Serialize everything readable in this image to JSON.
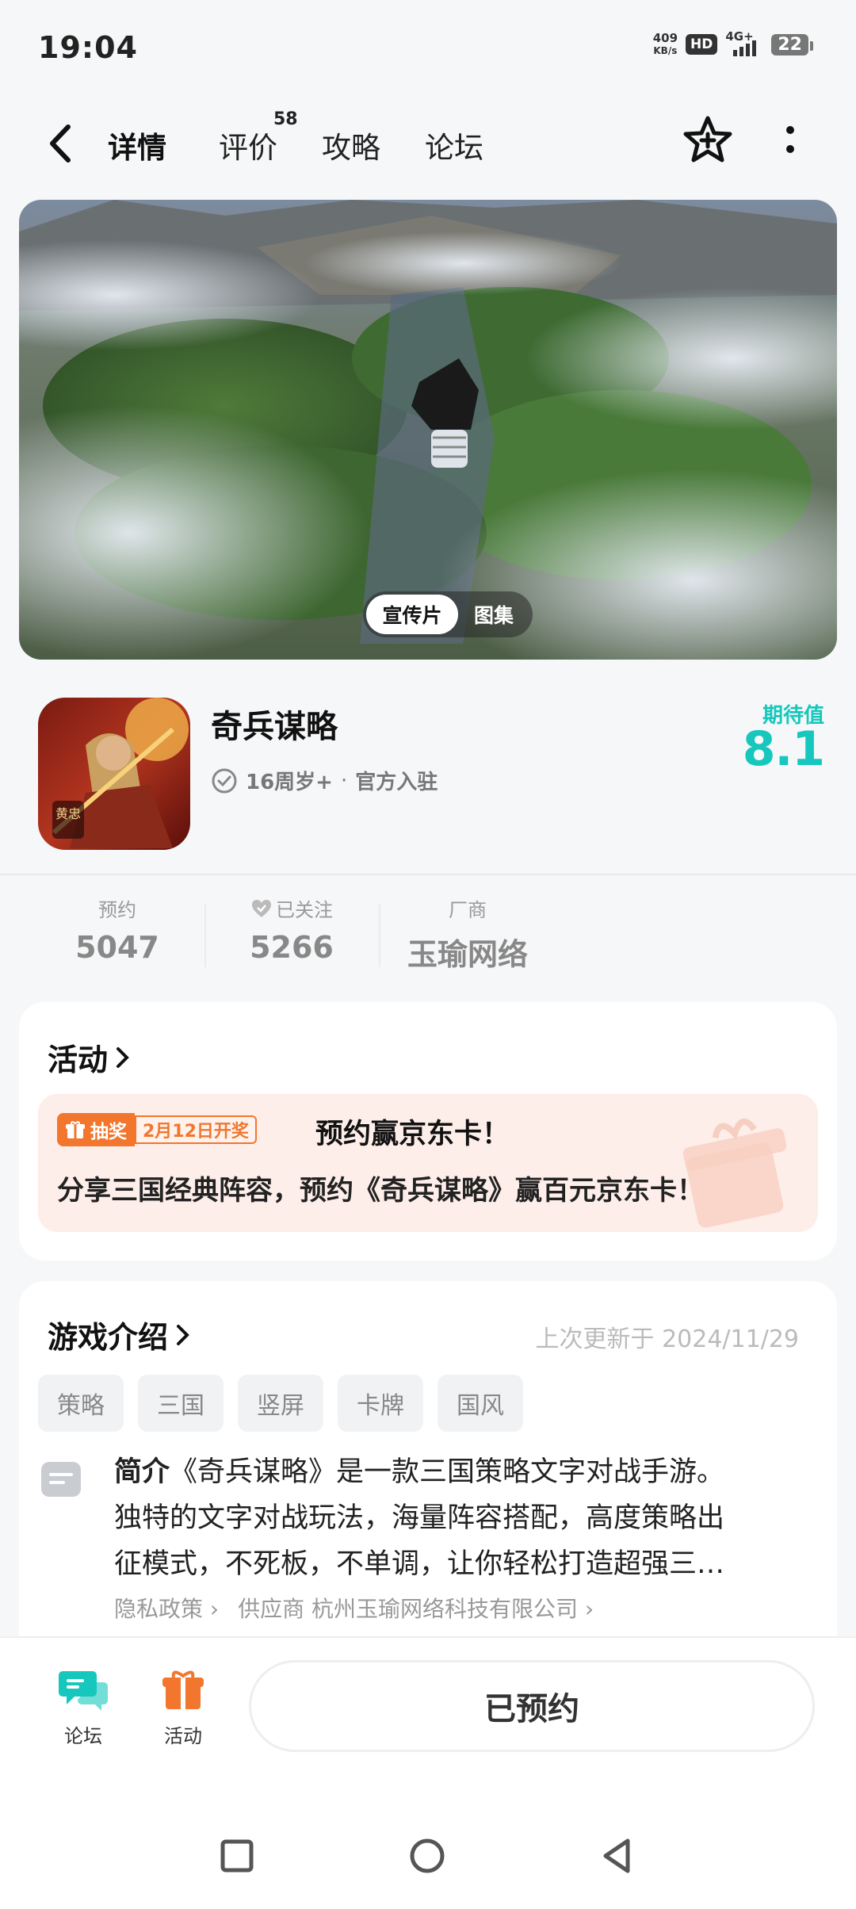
{
  "status_bar": {
    "time": "19:04",
    "net_speed_value": "409",
    "net_speed_unit": "KB/s",
    "hd": "HD",
    "network": "4G+",
    "battery": "22"
  },
  "nav": {
    "tabs": [
      "详情",
      "评价",
      "攻略",
      "论坛"
    ],
    "active_tab": "详情",
    "review_count": "58",
    "icons": [
      "back-icon",
      "star-plus-icon",
      "more-icon"
    ]
  },
  "hero": {
    "segments": [
      "宣传片",
      "图集"
    ],
    "active_segment": "宣传片"
  },
  "app": {
    "name": "奇兵谋略",
    "age_rating": "16周岁+",
    "official": "官方入驻",
    "separator": "·",
    "score_label": "期待值",
    "score": "8.1",
    "icon_text": "黄忠"
  },
  "stats": [
    {
      "label": "预约",
      "value": "5047"
    },
    {
      "label": "已关注",
      "value": "5266"
    },
    {
      "label": "厂商",
      "value": "玉瑜网络"
    }
  ],
  "activity": {
    "title": "活动",
    "badge_type": "抽奖",
    "badge_date": "2月12日开奖",
    "headline": "预约赢京东卡！",
    "description": "分享三国经典阵容，预约《奇兵谋略》赢百元京东卡！"
  },
  "intro": {
    "title": "游戏介绍",
    "update": "上次更新于 2024/11/29",
    "tags": [
      "策略",
      "三国",
      "竖屏",
      "卡牌",
      "国风"
    ],
    "label": "简介",
    "line1": "《奇兵谋略》是一款三国策略文字对战手游。",
    "line2": "独特的文字对战玩法，海量阵容搭配，高度策略出",
    "line3": "征模式，不死板，不单调，让你轻松打造超强三…",
    "privacy": "隐私政策",
    "supplier_label": "供应商",
    "supplier": "杭州玉瑜网络科技有限公司"
  },
  "bottom": {
    "forum_label": "论坛",
    "activity_label": "活动",
    "reserve_button": "已预约"
  },
  "colors": {
    "accent": "#16c7bd",
    "orange": "#f2762e"
  }
}
